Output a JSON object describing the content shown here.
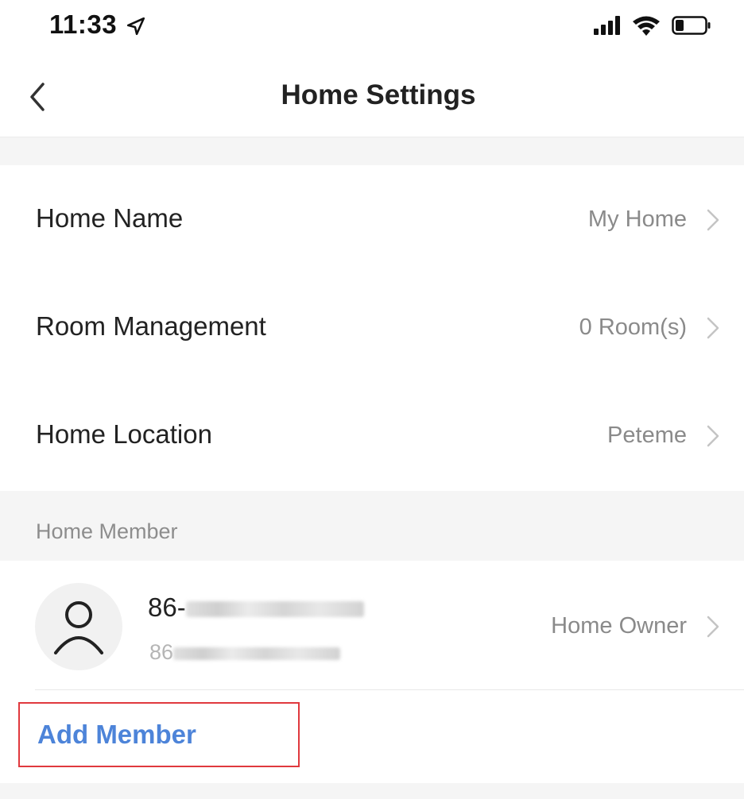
{
  "status_bar": {
    "time": "11:33",
    "icons": [
      "location-arrow-icon",
      "signal-icon",
      "wifi-icon",
      "battery-icon"
    ]
  },
  "nav": {
    "title": "Home Settings",
    "back_icon": "chevron-left-icon"
  },
  "settings": {
    "rows": [
      {
        "label": "Home Name",
        "value": "My Home"
      },
      {
        "label": "Room Management",
        "value": "0 Room(s)"
      },
      {
        "label": "Home Location",
        "value": "Peteme"
      }
    ]
  },
  "members": {
    "section_title": "Home Member",
    "items": [
      {
        "phone_prefix": "86-",
        "sub_prefix": "86",
        "role": "Home Owner",
        "avatar_icon": "user-icon"
      }
    ],
    "add_label": "Add Member"
  },
  "colors": {
    "accent": "#4d84d9",
    "highlight_border": "#e0393e",
    "secondary_text": "#8a8a8a",
    "background": "#f5f5f5"
  }
}
